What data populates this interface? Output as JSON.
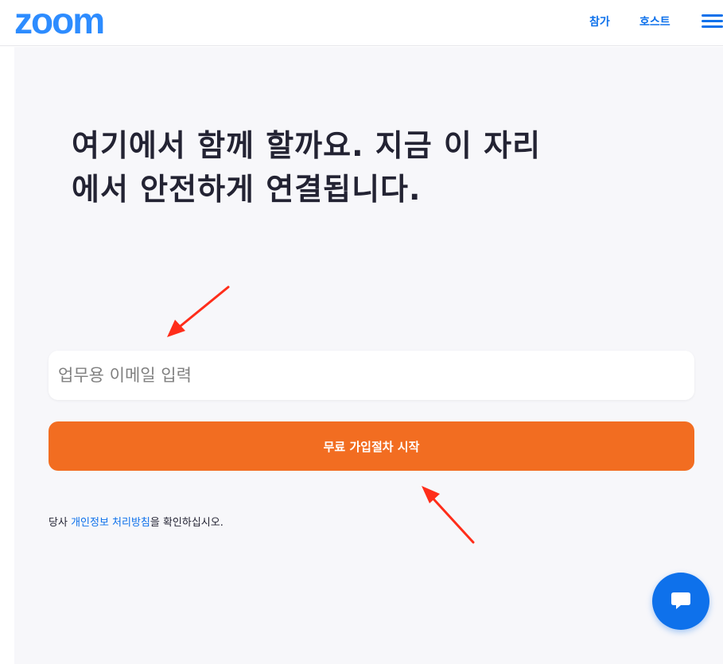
{
  "header": {
    "logo_text": "zoom",
    "nav": {
      "join_label": "참가",
      "host_label": "호스트"
    },
    "menu_icon": "hamburger-menu-icon"
  },
  "hero": {
    "headline_line1": "여기에서 함께 할까요. 지금 이 자리",
    "headline_line2": "에서 안전하게 연결됩니다.",
    "email_placeholder": "업무용 이메일 입력",
    "email_value": "",
    "signup_label": "무료 가입절차 시작",
    "privacy_prefix": "당사 ",
    "privacy_link": "개인정보 처리방침",
    "privacy_suffix": "을 확인하십시오."
  },
  "chat": {
    "icon": "chat-bubble-icon"
  },
  "annotations": {
    "arrow_color": "#ff2d1a"
  },
  "colors": {
    "brand_blue": "#2d8cff",
    "link_blue": "#0e71eb",
    "cta_orange": "#f26d21",
    "hero_bg": "#f7f7fa"
  }
}
